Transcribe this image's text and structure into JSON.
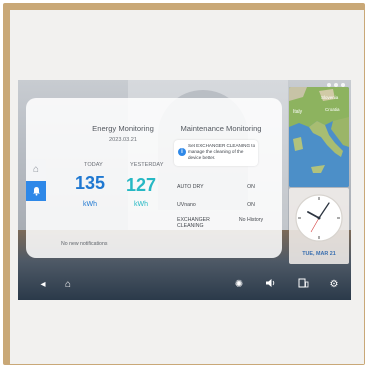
{
  "energy": {
    "title": "Energy Monitoring",
    "date": "2023.03.21",
    "today_label": "TODAY",
    "yesterday_label": "YESTERDAY",
    "today_value": "135",
    "yesterday_value": "127",
    "unit": "kWh"
  },
  "maintenance": {
    "title": "Maintenance Monitoring",
    "tip": "Set EXCHANGER CLEANING to manage the cleaning of the device better.",
    "rows": [
      {
        "label": "AUTO DRY",
        "value": "ON"
      },
      {
        "label": "UVnano",
        "value": "ON"
      },
      {
        "label": "EXCHANGER\nCLEANING",
        "value": "No History"
      }
    ]
  },
  "notifications": {
    "empty": "No new notifications"
  },
  "clock": {
    "date": "TUE, MAR 21"
  },
  "map_labels": [
    "Italy",
    "Slovenia",
    "Croatia"
  ],
  "icons": {
    "side": [
      "home-icon",
      "bell-icon"
    ],
    "nav": [
      "back-icon",
      "home-icon",
      "brightness-icon",
      "volume-icon",
      "screen-icon",
      "settings-icon"
    ]
  },
  "colors": {
    "accent_blue": "#2e88e8",
    "today_blue": "#1f78d1",
    "yesterday_teal": "#26b8c4",
    "frame_wood": "#c9a877"
  }
}
